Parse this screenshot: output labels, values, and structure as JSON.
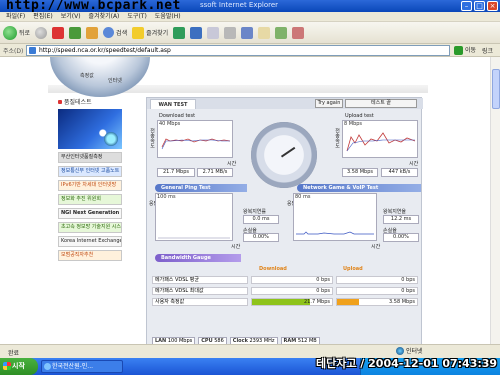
{
  "window": {
    "title": "ssoft Internet Explorer",
    "watermark": "http://www.bcpark.net"
  },
  "menu": [
    "파일(F)",
    "편집(E)",
    "보기(V)",
    "즐겨찾기(A)",
    "도구(T)",
    "도움말(H)"
  ],
  "toolbar": {
    "back_label": "뒤로",
    "search_label": "검색",
    "favorites_label": "즐겨찾기"
  },
  "address": {
    "label": "주소(D)",
    "url": "http://speed.nca.or.kr/speedtest/default.asp",
    "go_label": "이동",
    "links_label": "링크"
  },
  "logo": {
    "word1": "측정값",
    "word2": "인터넷"
  },
  "sidebar": {
    "heading": "품질테스트",
    "items": [
      "부산인터넷품질측정",
      "정보통신부 인터넷 고품노트",
      "IPv6기반 차세대 인터넷망",
      "정보화 추진 위원회",
      "NGI Next Generation",
      "초고속 정보망 기술지원 시스템",
      "Korea Internet Exchange",
      "모범공직자추천"
    ]
  },
  "panel": {
    "tab": "WAN TEST",
    "try_again": "Try again",
    "test_end": "테스트 끝",
    "download": {
      "title": "Download test",
      "scale": "40 Mbps",
      "axis": "시간",
      "ylabel": "전송속도",
      "mbps": "21.7 Mbps",
      "mbits": "2.71 MB/s"
    },
    "upload": {
      "title": "Upload test",
      "scale": "8 Mbps",
      "axis": "시간",
      "ylabel": "전송속도",
      "mbps": "3.58 Mbps",
      "kbs": "447 kB/s"
    },
    "ping": {
      "title": "General Ping Test",
      "scale": "100 ms",
      "ylabel": "응답",
      "axis": "시간",
      "latency_label": "왕복지연률",
      "latency": "0.0 ms",
      "loss_label": "손실율",
      "loss": "0.00%"
    },
    "voip": {
      "title": "Network Game & VoIP Test",
      "scale": "80 ms",
      "ylabel": "응답",
      "axis": "시간",
      "latency_label": "왕복지연율",
      "latency": "12.2 ms",
      "loss_label": "손실율",
      "loss": "0.00%"
    },
    "bandwidth": {
      "title": "Bandwidth Gauge",
      "download_label": "Download",
      "upload_label": "Upload",
      "rows": [
        {
          "label": "메가패스 VDSL 평균",
          "down": "0 bps",
          "up": "0 bps",
          "down_fill": 0,
          "up_fill": 0
        },
        {
          "label": "메가패스 VDSL 최대값",
          "down": "0 bps",
          "up": "0 bps",
          "down_fill": 0,
          "up_fill": 0
        },
        {
          "label": "사용자 측정값",
          "down": "21.7 Mbps",
          "up": "3.58 Mbps",
          "down_fill": 0.72,
          "up_fill": 0.28
        }
      ]
    },
    "system": {
      "lan_label": "LAN",
      "lan": "100 Mbps",
      "cpu_label": "CPU",
      "cpu": "586",
      "clock_label": "Clock",
      "clock": "2393 MHz",
      "ram_label": "RAM",
      "ram": "512 MB"
    }
  },
  "status": {
    "text": "완료",
    "zone": "인터넷"
  },
  "taskbar": {
    "start": "시작",
    "task": "한국전산원-인..."
  },
  "timestamp": "테단자고 / 2004-12-01 07:43:39"
}
